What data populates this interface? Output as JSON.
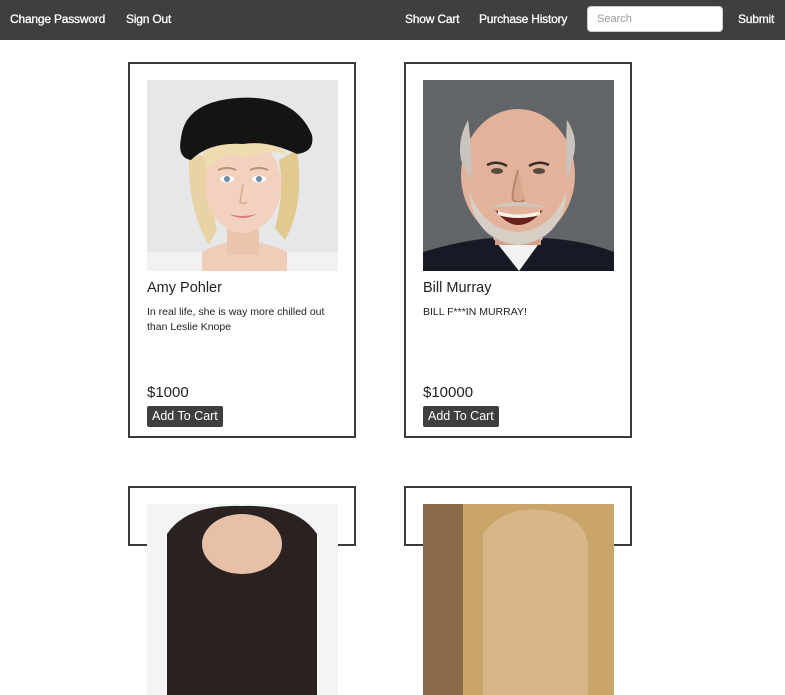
{
  "nav": {
    "change_password": "Change Password",
    "sign_out": "Sign Out",
    "show_cart": "Show Cart",
    "purchase_history": "Purchase History",
    "search_placeholder": "Search",
    "submit": "Submit"
  },
  "products": [
    {
      "name": "Amy Pohler",
      "description": "In real life, she is way more chilled out than Leslie Knope",
      "price": "$1000",
      "button": "Add To Cart"
    },
    {
      "name": "Bill Murray",
      "description": "BILL F***IN MURRAY!",
      "price": "$10000",
      "button": "Add To Cart"
    }
  ],
  "colors": {
    "navbar": "#3f3f3f",
    "button": "#3f3f3f",
    "card_border": "#3a3a3a"
  }
}
